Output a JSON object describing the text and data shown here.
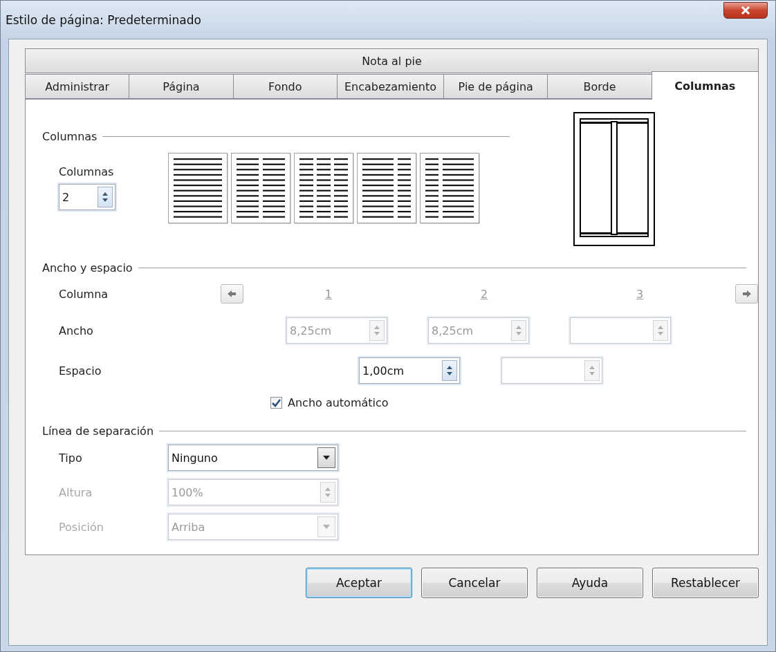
{
  "window": {
    "title": "Estilo de página: Predeterminado"
  },
  "tab_rows": [
    {
      "tabs": [
        {
          "label": "Nota al pie",
          "selected": false
        }
      ]
    },
    {
      "tabs": [
        {
          "label": "Administrar",
          "selected": false
        },
        {
          "label": "Página",
          "selected": false
        },
        {
          "label": "Fondo",
          "selected": false
        },
        {
          "label": "Encabezamiento",
          "selected": false
        },
        {
          "label": "Pie de página",
          "selected": false
        },
        {
          "label": "Borde",
          "selected": false
        },
        {
          "label": "Columnas",
          "selected": true
        }
      ]
    }
  ],
  "columns_section": {
    "title": "Columnas",
    "label": "Columnas",
    "value": "2",
    "presets": [
      {
        "kind": "one"
      },
      {
        "kind": "two"
      },
      {
        "kind": "three"
      },
      {
        "kind": "left-wide"
      },
      {
        "kind": "right-wide"
      }
    ]
  },
  "width_spacing": {
    "title": "Ancho y espacio",
    "column_label": "Columna",
    "column_numbers": [
      "1",
      "2",
      "3"
    ],
    "width_label": "Ancho",
    "widths": [
      {
        "value": "8,25cm",
        "disabled": true
      },
      {
        "value": "8,25cm",
        "disabled": true
      },
      {
        "disabled": true
      }
    ],
    "spacing_label": "Espacio",
    "spacings": [
      {
        "value": "1,00cm",
        "disabled": false
      },
      {
        "disabled": true
      }
    ],
    "auto_width": {
      "label": "Ancho automático",
      "checked": true
    }
  },
  "separator": {
    "title": "Línea de separación",
    "rows": [
      {
        "kind": "dropdown",
        "label": "Tipo",
        "value": "Ninguno",
        "disabled": false
      },
      {
        "kind": "spin",
        "label": "Altura",
        "value": "100%",
        "disabled": true
      },
      {
        "kind": "dropdown",
        "label": "Posición",
        "value": "Arriba",
        "disabled": true
      }
    ]
  },
  "buttons": [
    {
      "label": "Aceptar",
      "default": true
    },
    {
      "label": "Cancelar",
      "default": false
    },
    {
      "label": "Ayuda",
      "default": false
    },
    {
      "label": "Restablecer",
      "default": false
    }
  ]
}
